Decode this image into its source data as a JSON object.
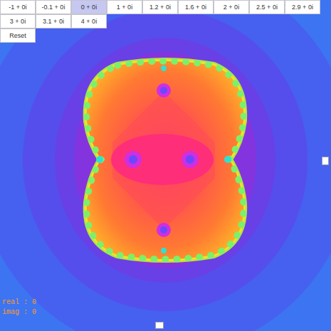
{
  "presets": [
    {
      "label": "-1 + 0i",
      "selected": false
    },
    {
      "label": "-0.1 + 0i",
      "selected": false
    },
    {
      "label": "0 + 0i",
      "selected": true
    },
    {
      "label": "1 + 0i",
      "selected": false
    },
    {
      "label": "1.2 + 0i",
      "selected": false
    },
    {
      "label": "1.6 + 0i",
      "selected": false
    },
    {
      "label": "2 + 0i",
      "selected": false
    },
    {
      "label": "2.5 + 0i",
      "selected": false
    },
    {
      "label": "2.9 + 0i",
      "selected": false
    },
    {
      "label": "3 + 0i",
      "selected": false
    },
    {
      "label": "3.1 + 0i",
      "selected": false
    },
    {
      "label": "4 + 0i",
      "selected": false
    }
  ],
  "reset_button": {
    "label": "Reset"
  },
  "readouts": [
    {
      "label": "real : 0"
    },
    {
      "label": "imag : 0"
    }
  ],
  "sliders": [
    {
      "kind": "vertical",
      "level": 0.485
    },
    {
      "kind": "horizontal",
      "level": 0.482
    }
  ]
}
